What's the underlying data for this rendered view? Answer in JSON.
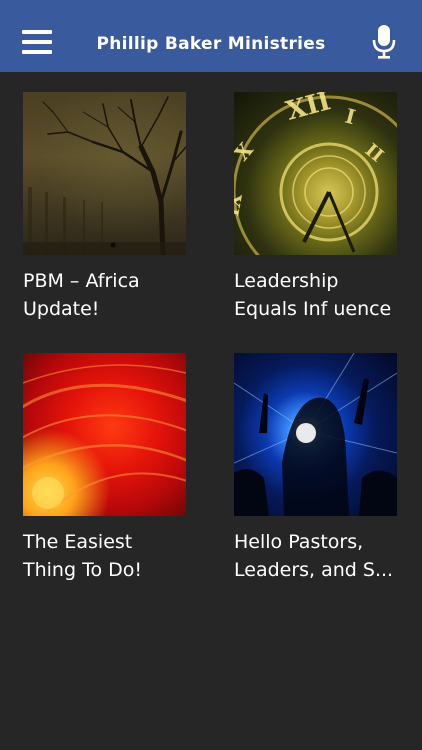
{
  "app": {
    "title": "Phillip Baker Ministries"
  },
  "header": {
    "menu_icon": "hamburger-menu-icon",
    "mic_icon": "microphone-icon",
    "bar_color": "#3a5a9e"
  },
  "posts": [
    {
      "title": "PBM – Africa\nUpdate!",
      "image": "foggy-tree-forest"
    },
    {
      "title": "Leadership\nEquals Inf uence",
      "image": "golden-clock-face"
    },
    {
      "title": "The Easiest\nThing To Do!",
      "image": "red-orange-light-swirl"
    },
    {
      "title": "Hello Pastors,\nLeaders, and S...",
      "image": "worship-crowd-blue-lights"
    }
  ]
}
